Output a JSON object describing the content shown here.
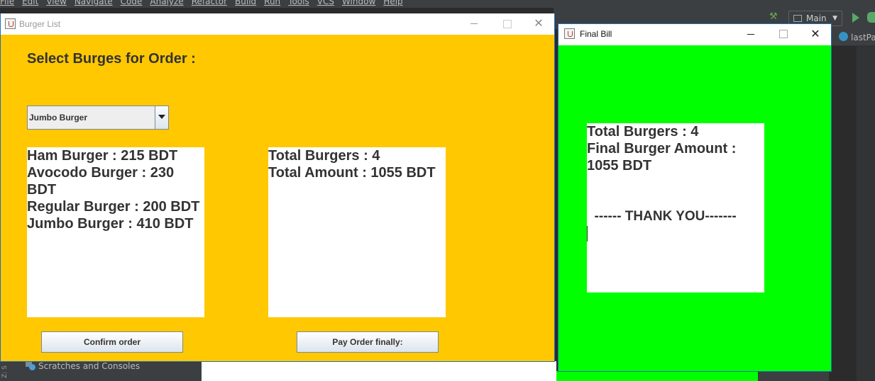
{
  "ide": {
    "menu": [
      "File",
      "Edit",
      "View",
      "Navigate",
      "Code",
      "Analyze",
      "Refactor",
      "Build",
      "Run",
      "Tools",
      "VCS",
      "Window",
      "Help"
    ],
    "run_config": "Main",
    "editor_tab": "lastPa",
    "scratches_label": "Scratches and Consoles",
    "sidebar_strip": "Z: S"
  },
  "burger_window": {
    "title": "Burger List",
    "heading": "Select Burges for Order :",
    "combo_selected": "Jumbo Burger",
    "menu_lines": [
      "Ham Burger  : 215 BDT",
      "Avocodo Burger  : 230",
      "BDT",
      "Regular Burger  : 200 BDT",
      "Jumbo Burger  : 410 BDT"
    ],
    "summary_lines": [
      "Total Burgers : 4",
      "Total Amount : 1055 BDT"
    ],
    "confirm_label": "Confirm order",
    "pay_label": "Pay Order finally:",
    "colors": {
      "background": "#ffc800"
    }
  },
  "bill_window": {
    "title": "Final Bill",
    "lines": [
      "Total Burgers : 4",
      "Final Burger Amount :",
      "1055 BDT"
    ],
    "thanks": "  ------ THANK YOU-------",
    "colors": {
      "background": "#00ff00"
    }
  }
}
